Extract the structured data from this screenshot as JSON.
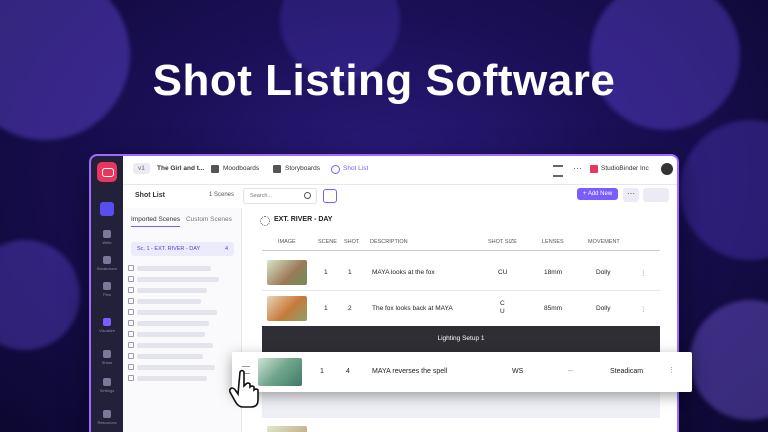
{
  "headline": "Shot Listing Software",
  "app": {
    "project_badge": "v1",
    "project_name": "The Girl and t...",
    "nav_tabs": [
      {
        "label": "Moodboards"
      },
      {
        "label": "Storyboards"
      },
      {
        "label": "Shot List"
      }
    ],
    "account": "StudioBinder Inc",
    "toolbar": {
      "title": "Shot List",
      "scenes_count": "1 Scenes",
      "search_placeholder": "Search...",
      "add_new": "+ Add New"
    },
    "sidebar": {
      "tab_imported": "Imported Scenes",
      "tab_custom": "Custom Scenes",
      "scene_label": "Sc. 1 - EXT. RIVER - DAY",
      "scene_count": "4"
    },
    "rail": [
      {
        "label": "Write"
      },
      {
        "label": "Breakdown"
      },
      {
        "label": "Plan"
      },
      {
        "label": "Visualize"
      },
      {
        "label": "Share"
      },
      {
        "label": "Settings"
      },
      {
        "label": "Resources"
      }
    ],
    "scene_header": "EXT. RIVER - DAY",
    "columns": {
      "image": "IMAGE",
      "scene": "SCENE",
      "shot": "SHOT",
      "description": "DESCRIPTION",
      "shot_size": "SHOT SIZE",
      "lenses": "LENSES",
      "movement": "MOVEMENT"
    },
    "rows": [
      {
        "scene": "1",
        "shot": "1",
        "description": "MAYA looks at the fox",
        "shot_size": "CU",
        "lenses": "18mm",
        "movement": "Dolly"
      },
      {
        "scene": "1",
        "shot": "2",
        "description": "The fox looks back at MAYA",
        "shot_size": "C\nU",
        "lenses": "85mm",
        "movement": "Dolly"
      }
    ],
    "lighting_setup": "Lighting Setup 1",
    "dragged_row": {
      "scene": "1",
      "shot": "4",
      "description": "MAYA reverses the spell",
      "shot_size": "WS",
      "lenses": "--",
      "movement": "Steadicam"
    }
  },
  "colors": {
    "accent": "#7b5cff",
    "brand": "#e8375a",
    "rail": "#23213a"
  }
}
